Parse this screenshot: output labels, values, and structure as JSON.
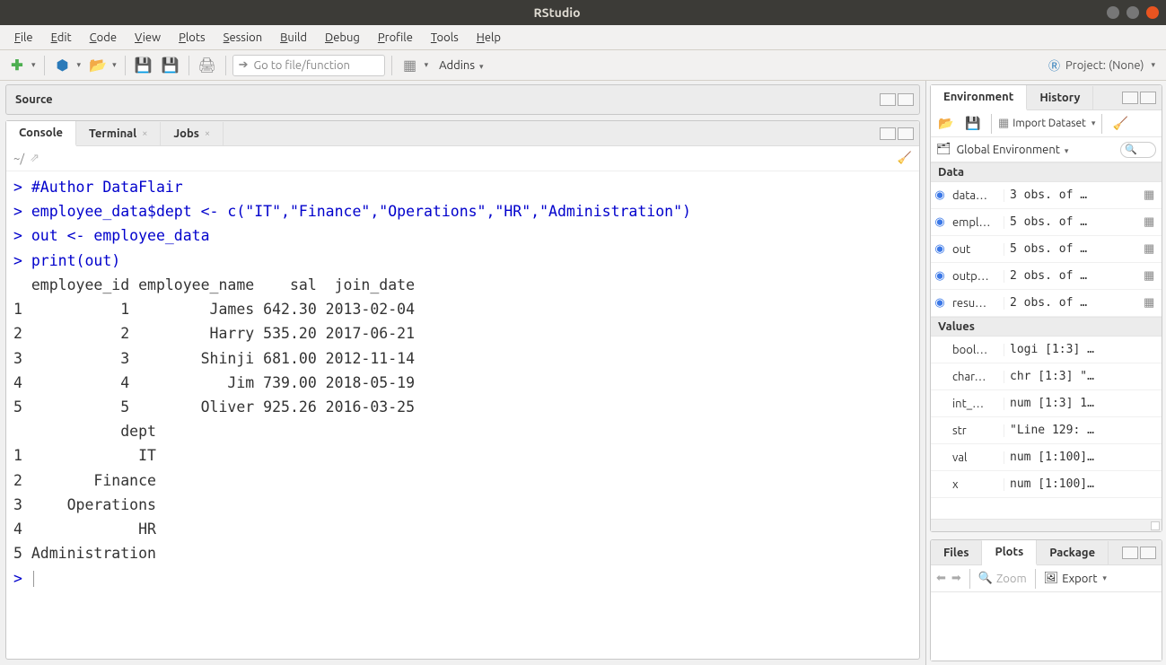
{
  "window": {
    "title": "RStudio"
  },
  "menus": [
    "File",
    "Edit",
    "Code",
    "View",
    "Plots",
    "Session",
    "Build",
    "Debug",
    "Profile",
    "Tools",
    "Help"
  ],
  "toolbar": {
    "goto_placeholder": "Go to file/function",
    "addins_label": "Addins",
    "project_label": "Project: (None)"
  },
  "source": {
    "title": "Source"
  },
  "console_tabs": {
    "console": "Console",
    "terminal": "Terminal",
    "jobs": "Jobs"
  },
  "console": {
    "cwd": "~/",
    "lines": [
      {
        "type": "cmd",
        "text": "#Author DataFlair"
      },
      {
        "type": "cmd",
        "text": "employee_data$dept <- c(\"IT\",\"Finance\",\"Operations\",\"HR\",\"Administration\")"
      },
      {
        "type": "cmd",
        "text": "out <- employee_data"
      },
      {
        "type": "cmd",
        "text": "print(out)"
      },
      {
        "type": "out",
        "text": "  employee_id employee_name    sal  join_date"
      },
      {
        "type": "out",
        "text": "1           1         James 642.30 2013-02-04"
      },
      {
        "type": "out",
        "text": "2           2         Harry 535.20 2017-06-21"
      },
      {
        "type": "out",
        "text": "3           3        Shinji 681.00 2012-11-14"
      },
      {
        "type": "out",
        "text": "4           4           Jim 739.00 2018-05-19"
      },
      {
        "type": "out",
        "text": "5           5        Oliver 925.26 2016-03-25"
      },
      {
        "type": "out",
        "text": "            dept"
      },
      {
        "type": "out",
        "text": "1             IT"
      },
      {
        "type": "out",
        "text": "2        Finance"
      },
      {
        "type": "out",
        "text": "3     Operations"
      },
      {
        "type": "out",
        "text": "4             HR"
      },
      {
        "type": "out",
        "text": "5 Administration"
      }
    ]
  },
  "env_tabs": {
    "environment": "Environment",
    "history": "History"
  },
  "env_toolbar": {
    "import": "Import Dataset",
    "scope": "Global Environment"
  },
  "env": {
    "data_header": "Data",
    "values_header": "Values",
    "data": [
      {
        "name": "data…",
        "value": "3 obs. of …"
      },
      {
        "name": "empl…",
        "value": "5 obs. of …"
      },
      {
        "name": "out",
        "value": "5 obs. of …"
      },
      {
        "name": "outp…",
        "value": "2 obs. of …"
      },
      {
        "name": "resu…",
        "value": "2 obs. of …"
      }
    ],
    "values": [
      {
        "name": "bool…",
        "value": "logi [1:3] …"
      },
      {
        "name": "char…",
        "value": "chr [1:3] \"…"
      },
      {
        "name": "int_…",
        "value": "num [1:3] 1…"
      },
      {
        "name": "str",
        "value": "\"Line 129: …"
      },
      {
        "name": "val",
        "value": "num [1:100]…"
      },
      {
        "name": "x",
        "value": "num [1:100]…"
      }
    ]
  },
  "plots_tabs": {
    "files": "Files",
    "plots": "Plots",
    "packages": "Package"
  },
  "plots_toolbar": {
    "zoom": "Zoom",
    "export": "Export"
  }
}
